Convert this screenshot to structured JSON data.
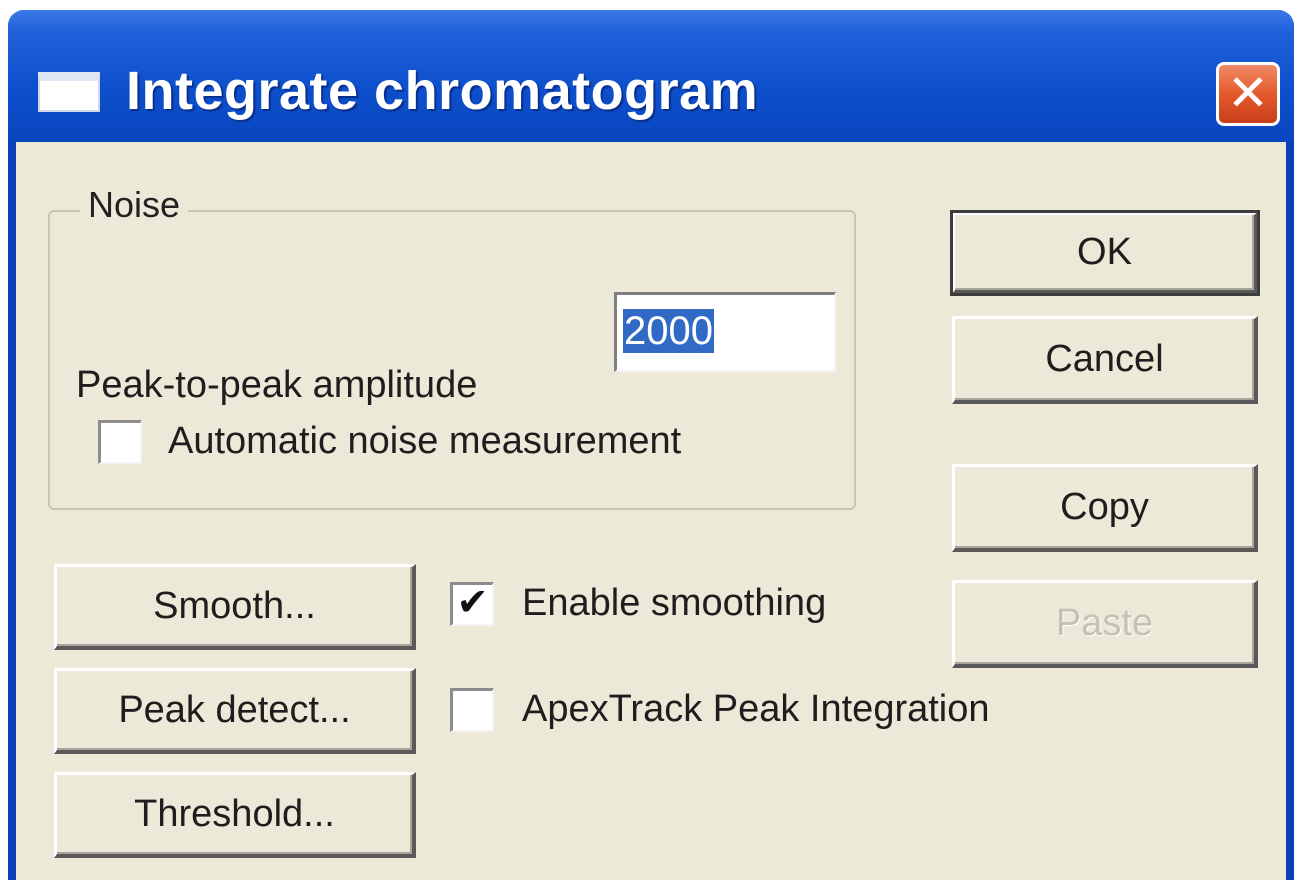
{
  "window": {
    "title": "Integrate chromatogram",
    "close_glyph": "✕"
  },
  "noise_group": {
    "legend": "Noise",
    "amplitude_label": "Peak-to-peak amplitude",
    "amplitude_value": "2000",
    "auto_noise_label": "Automatic noise measurement",
    "auto_noise_checked": false
  },
  "buttons": {
    "ok": "OK",
    "cancel": "Cancel",
    "copy": "Copy",
    "paste": "Paste",
    "smooth": "Smooth...",
    "peak_detect": "Peak detect...",
    "threshold": "Threshold..."
  },
  "options": {
    "enable_smoothing_label": "Enable smoothing",
    "enable_smoothing_checked": true,
    "apextrack_label": "ApexTrack Peak Integration",
    "apextrack_checked": false,
    "check_glyph": "✔"
  },
  "colors": {
    "titlebar": "#0a46bf",
    "dialog_face": "#ece9d8",
    "selection": "#316ac5",
    "close_button": "#e45a2c"
  },
  "icons": {
    "title_icon": "window-icon",
    "close": "close-icon"
  }
}
